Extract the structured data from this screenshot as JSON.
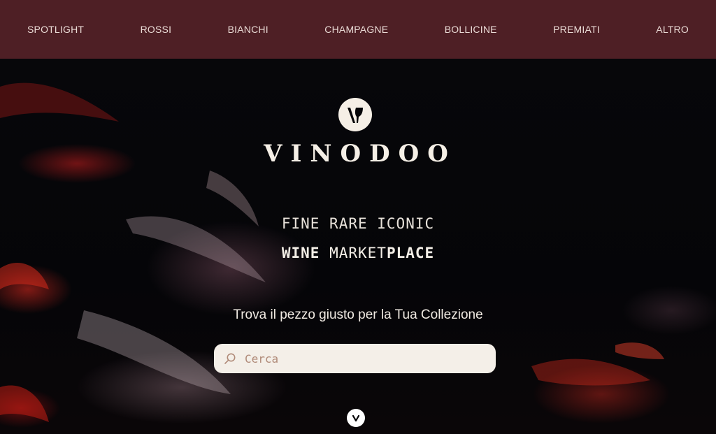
{
  "nav": {
    "items": [
      {
        "label": "SPOTLIGHT"
      },
      {
        "label": "ROSSI"
      },
      {
        "label": "BIANCHI"
      },
      {
        "label": "CHAMPAGNE"
      },
      {
        "label": "BOLLICINE"
      },
      {
        "label": "PREMIATI"
      },
      {
        "label": "ALTRO"
      }
    ]
  },
  "hero": {
    "brand": "VINODOO",
    "tagline_line1": "FINE RARE ICONIC",
    "tagline_line2": {
      "word1": "WINE",
      "word2": "MARKET",
      "word3": "PLACE"
    },
    "subtitle": "Trova il pezzo giusto per la Tua Collezione"
  },
  "search": {
    "placeholder": "Cerca",
    "icon": "search-icon"
  },
  "icons": {
    "logo": "wine-glass-logo-icon",
    "scroll": "chevron-down-icon"
  },
  "colors": {
    "nav_background": "#4e1f25",
    "nav_text": "#eadbd6",
    "hero_background": "#050507",
    "search_background": "#f4efe8",
    "search_placeholder": "#b08a78"
  }
}
